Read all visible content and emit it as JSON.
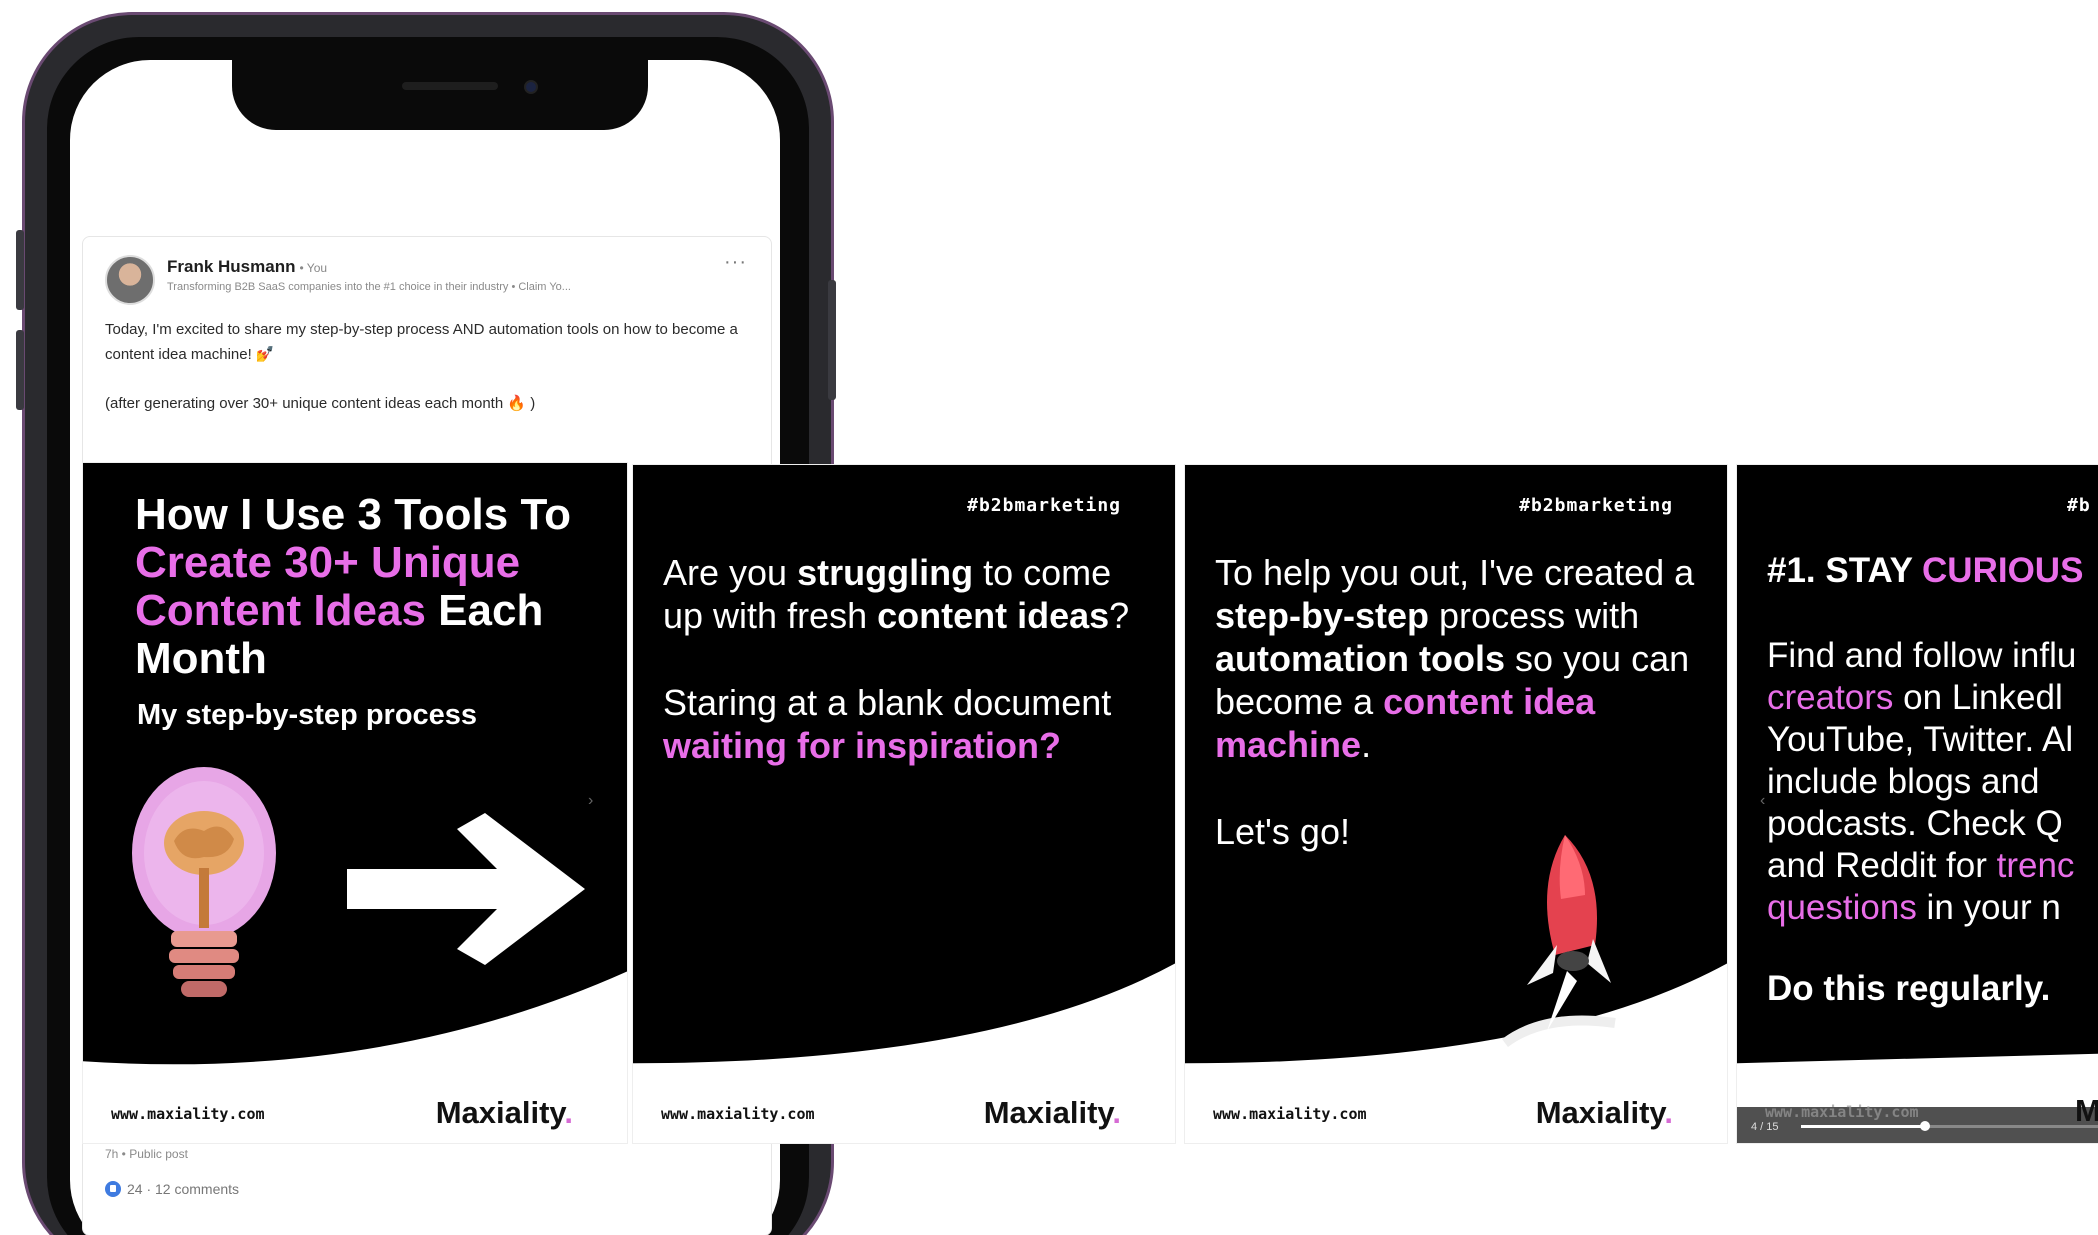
{
  "post": {
    "author": "Frank Husmann",
    "author_suffix": "• You",
    "tagline": "Transforming B2B SaaS companies into the #1 choice in their industry • Claim Yo...",
    "more": "···",
    "paragraph1": "Today, I'm excited to share my step-by-step process AND automation tools on how to become a content idea machine! 💅",
    "paragraph2": "(after generating over 30+ unique content ideas each month 🔥 )",
    "meta": "7h • Public post",
    "reactions": "24 · 12 comments"
  },
  "slides": {
    "hashtag": "#b2bmarketing",
    "hashtag_partial": "#b",
    "url": "www.maxiality.com",
    "brand": "Maxiality",
    "brand_dot": ".",
    "brand_partial": "M",
    "s1": {
      "title_line1": "How I Use 3 Tools To",
      "title_pink": "Create 30+ Unique Content Ideas",
      "title_end": "Each Month",
      "subtitle": "My step-by-step process"
    },
    "s2": {
      "t1": "Are you ",
      "t1b": "struggling",
      "t1c": " to come up with fresh ",
      "t1d": "content ideas",
      "t1e": "?",
      "t2": "Staring at a blank document ",
      "t2p": "waiting for inspiration?"
    },
    "s3": {
      "t1": "To help you out, I've created a ",
      "t1b": "step-by-step",
      "t1c": " process with ",
      "t1d": "automation tools",
      "t1e": " so you can  become a ",
      "t1f": "content idea machine",
      "t1g": ".",
      "t2": "Let's go!"
    },
    "s4": {
      "head_num": "#1. STAY ",
      "head_pink": "CURIOUS",
      "l1": "Find and follow influ",
      "l2p": "creators",
      "l2": " on Linkedl",
      "l3": "YouTube, Twitter. Al",
      "l4": "include blogs and",
      "l5": "podcasts. Check Q",
      "l6": "and Reddit for ",
      "l6p": "trenc",
      "l7p": "questions",
      "l7": " in your n",
      "bold": "Do this regularly.",
      "progress_label": "4 / 15",
      "progress_fraction": 0.27
    }
  },
  "colors": {
    "accent": "#e86ee8",
    "slide_bg": "#000000"
  }
}
